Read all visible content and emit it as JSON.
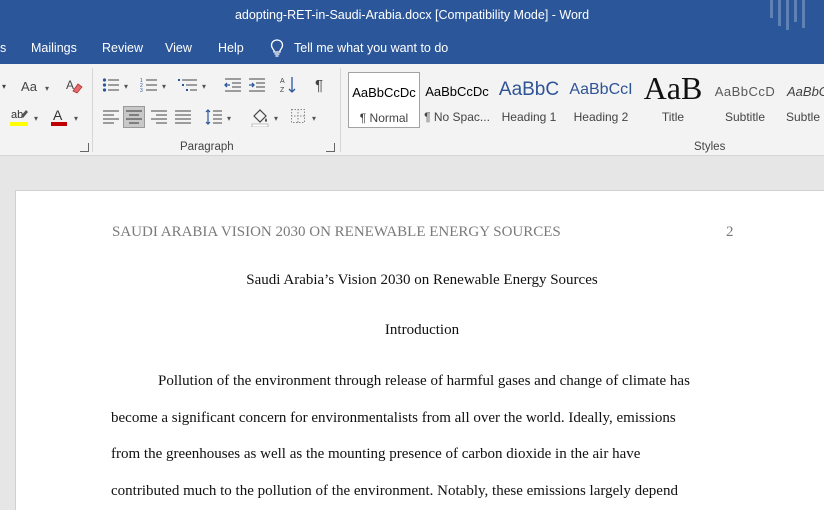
{
  "window": {
    "title": "adopting-RET-in-Saudi-Arabia.docx [Compatibility Mode]  -  Word"
  },
  "menu": {
    "items": [
      "s",
      "Mailings",
      "Review",
      "View",
      "Help"
    ],
    "tell_me": "Tell me what you want to do"
  },
  "ribbon": {
    "font_group": {
      "change_case": "Aa"
    },
    "paragraph_group": {
      "label": "Paragraph"
    },
    "styles_group": {
      "label": "Styles",
      "styles": [
        {
          "preview": "AaBbCcDc",
          "name": "¶ Normal",
          "color": "#000000"
        },
        {
          "preview": "AaBbCcDc",
          "name": "¶ No Spac...",
          "color": "#000000"
        },
        {
          "preview": "AaBbC",
          "name": "Heading 1",
          "color": "#2f5496"
        },
        {
          "preview": "AaBbCcI",
          "name": "Heading 2",
          "color": "#2f5496"
        },
        {
          "preview": "AaB",
          "name": "Title",
          "color": "#000000"
        },
        {
          "preview": "AaBbCcD",
          "name": "Subtitle",
          "color": "#595959"
        },
        {
          "preview": "AaBbC",
          "name": "Subtle E",
          "color": "#404040"
        }
      ]
    }
  },
  "document": {
    "running_head": "SAUDI ARABIA VISION 2030 ON RENEWABLE ENERGY SOURCES",
    "page_number": "2",
    "title": "Saudi Arabia’s Vision 2030 on Renewable Energy Sources",
    "heading": "Introduction",
    "lines": [
      "Pollution of the environment through release of harmful gases and change of climate has",
      "become a significant concern for environmentalists from all over the world. Ideally, emissions",
      "from the greenhouses as well as the mounting presence of carbon dioxide in the air have",
      "contributed much to the pollution of the environment. Notably, these emissions largely depend"
    ]
  },
  "colors": {
    "accent": "#2b579a",
    "ribbon_bg": "#f3f3f3",
    "font_color_red": "#c00000",
    "highlight_yellow": "#ffff00"
  }
}
